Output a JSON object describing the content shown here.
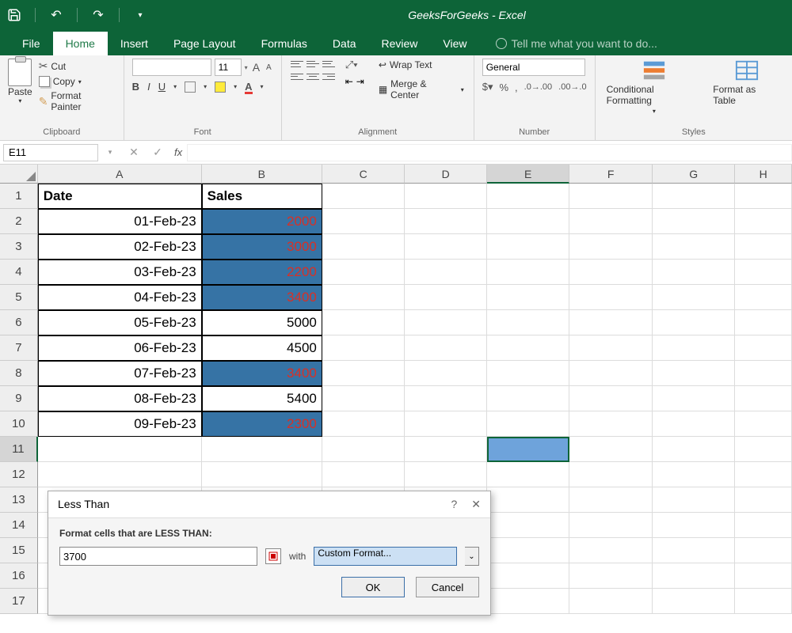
{
  "app": {
    "title": "GeeksForGeeks - Excel"
  },
  "tabs": {
    "file": "File",
    "home": "Home",
    "insert": "Insert",
    "pageLayout": "Page Layout",
    "formulas": "Formulas",
    "data": "Data",
    "review": "Review",
    "view": "View",
    "tellMe": "Tell me what you want to do..."
  },
  "ribbon": {
    "clipboard": {
      "paste": "Paste",
      "cut": "Cut",
      "copy": "Copy",
      "formatPainter": "Format Painter",
      "label": "Clipboard"
    },
    "font": {
      "sizeValue": "11",
      "label": "Font"
    },
    "alignment": {
      "wrap": "Wrap Text",
      "merge": "Merge & Center",
      "label": "Alignment"
    },
    "number": {
      "format": "General",
      "label": "Number"
    },
    "styles": {
      "cf": "Conditional Formatting",
      "fat": "Format as Table",
      "label": "Styles"
    }
  },
  "fbar": {
    "namebox": "E11"
  },
  "columns": [
    "A",
    "B",
    "C",
    "D",
    "E",
    "F",
    "G",
    "H"
  ],
  "rows": [
    "1",
    "2",
    "3",
    "4",
    "5",
    "6",
    "7",
    "8",
    "9",
    "10",
    "11",
    "12",
    "13",
    "14",
    "15",
    "16",
    "17"
  ],
  "sheet": {
    "headerA": "Date",
    "headerB": "Sales",
    "data": [
      {
        "date": "01-Feb-23",
        "sales": "2000",
        "hl": true
      },
      {
        "date": "02-Feb-23",
        "sales": "3000",
        "hl": true
      },
      {
        "date": "03-Feb-23",
        "sales": "2200",
        "hl": true
      },
      {
        "date": "04-Feb-23",
        "sales": "3400",
        "hl": true
      },
      {
        "date": "05-Feb-23",
        "sales": "5000",
        "hl": false
      },
      {
        "date": "06-Feb-23",
        "sales": "4500",
        "hl": false
      },
      {
        "date": "07-Feb-23",
        "sales": "3400",
        "hl": true
      },
      {
        "date": "08-Feb-23",
        "sales": "5400",
        "hl": false
      },
      {
        "date": "09-Feb-23",
        "sales": "2300",
        "hl": true
      }
    ]
  },
  "dialog": {
    "title": "Less Than",
    "prompt": "Format cells that are LESS THAN:",
    "value": "3700",
    "withLabel": "with",
    "format": "Custom Format...",
    "ok": "OK",
    "cancel": "Cancel"
  }
}
